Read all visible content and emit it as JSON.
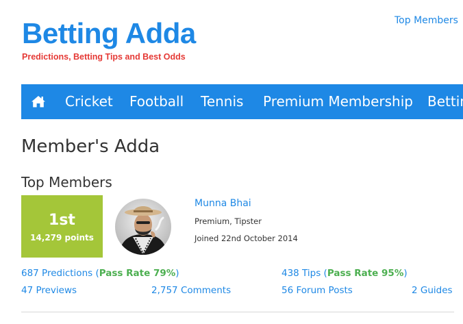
{
  "header": {
    "logo_title": "Betting Adda",
    "logo_tagline": "Predictions, Betting Tips and Best Odds",
    "top_link": "Top Members"
  },
  "nav": {
    "home_icon": "home-icon",
    "items": [
      "Cricket",
      "Football",
      "Tennis",
      "Premium Membership",
      "Betting"
    ]
  },
  "page": {
    "title": "Member's Adda",
    "section_title": "Top Members"
  },
  "member": {
    "rank": "1st",
    "points": "14,279 points",
    "name": "Munna Bhai",
    "roles": "Premium, Tipster",
    "joined": "Joined 22nd October 2014",
    "predictions": "687 Predictions",
    "predictions_pass_open": " (",
    "predictions_pass": "Pass Rate 79%",
    "predictions_pass_close": ")",
    "tips": "438 Tips",
    "tips_pass_open": " (",
    "tips_pass": "Pass Rate 95%",
    "tips_pass_close": ")",
    "previews": "47 Previews",
    "comments": "2,757 Comments",
    "forum_posts": "56 Forum Posts",
    "guides": "2 Guides"
  },
  "colors": {
    "brand_blue": "#1e88e5",
    "tagline_red": "#e53935",
    "rank_green": "#a4c639",
    "pass_green": "#4caf50"
  }
}
